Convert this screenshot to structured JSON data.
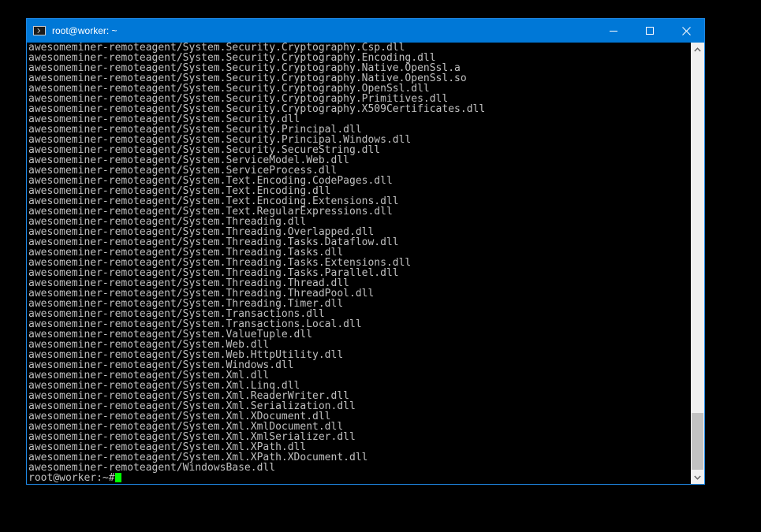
{
  "window": {
    "title": "root@worker: ~",
    "icon": "terminal-icon"
  },
  "controls": {
    "minimize_icon": "minimize-icon",
    "maximize_icon": "maximize-icon",
    "close_icon": "close-icon"
  },
  "terminal": {
    "lines": [
      "awesomeminer-remoteagent/System.Security.Cryptography.Csp.dll",
      "awesomeminer-remoteagent/System.Security.Cryptography.Encoding.dll",
      "awesomeminer-remoteagent/System.Security.Cryptography.Native.OpenSsl.a",
      "awesomeminer-remoteagent/System.Security.Cryptography.Native.OpenSsl.so",
      "awesomeminer-remoteagent/System.Security.Cryptography.OpenSsl.dll",
      "awesomeminer-remoteagent/System.Security.Cryptography.Primitives.dll",
      "awesomeminer-remoteagent/System.Security.Cryptography.X509Certificates.dll",
      "awesomeminer-remoteagent/System.Security.dll",
      "awesomeminer-remoteagent/System.Security.Principal.dll",
      "awesomeminer-remoteagent/System.Security.Principal.Windows.dll",
      "awesomeminer-remoteagent/System.Security.SecureString.dll",
      "awesomeminer-remoteagent/System.ServiceModel.Web.dll",
      "awesomeminer-remoteagent/System.ServiceProcess.dll",
      "awesomeminer-remoteagent/System.Text.Encoding.CodePages.dll",
      "awesomeminer-remoteagent/System.Text.Encoding.dll",
      "awesomeminer-remoteagent/System.Text.Encoding.Extensions.dll",
      "awesomeminer-remoteagent/System.Text.RegularExpressions.dll",
      "awesomeminer-remoteagent/System.Threading.dll",
      "awesomeminer-remoteagent/System.Threading.Overlapped.dll",
      "awesomeminer-remoteagent/System.Threading.Tasks.Dataflow.dll",
      "awesomeminer-remoteagent/System.Threading.Tasks.dll",
      "awesomeminer-remoteagent/System.Threading.Tasks.Extensions.dll",
      "awesomeminer-remoteagent/System.Threading.Tasks.Parallel.dll",
      "awesomeminer-remoteagent/System.Threading.Thread.dll",
      "awesomeminer-remoteagent/System.Threading.ThreadPool.dll",
      "awesomeminer-remoteagent/System.Threading.Timer.dll",
      "awesomeminer-remoteagent/System.Transactions.dll",
      "awesomeminer-remoteagent/System.Transactions.Local.dll",
      "awesomeminer-remoteagent/System.ValueTuple.dll",
      "awesomeminer-remoteagent/System.Web.dll",
      "awesomeminer-remoteagent/System.Web.HttpUtility.dll",
      "awesomeminer-remoteagent/System.Windows.dll",
      "awesomeminer-remoteagent/System.Xml.dll",
      "awesomeminer-remoteagent/System.Xml.Linq.dll",
      "awesomeminer-remoteagent/System.Xml.ReaderWriter.dll",
      "awesomeminer-remoteagent/System.Xml.Serialization.dll",
      "awesomeminer-remoteagent/System.Xml.XDocument.dll",
      "awesomeminer-remoteagent/System.Xml.XmlDocument.dll",
      "awesomeminer-remoteagent/System.Xml.XmlSerializer.dll",
      "awesomeminer-remoteagent/System.Xml.XPath.dll",
      "awesomeminer-remoteagent/System.Xml.XPath.XDocument.dll",
      "awesomeminer-remoteagent/WindowsBase.dll"
    ],
    "prompt": "root@worker:~# ",
    "cursor_color": "#00ff00"
  },
  "colors": {
    "titlebar": "#0078d7",
    "text": "#c0c0c0",
    "background": "#000000"
  }
}
